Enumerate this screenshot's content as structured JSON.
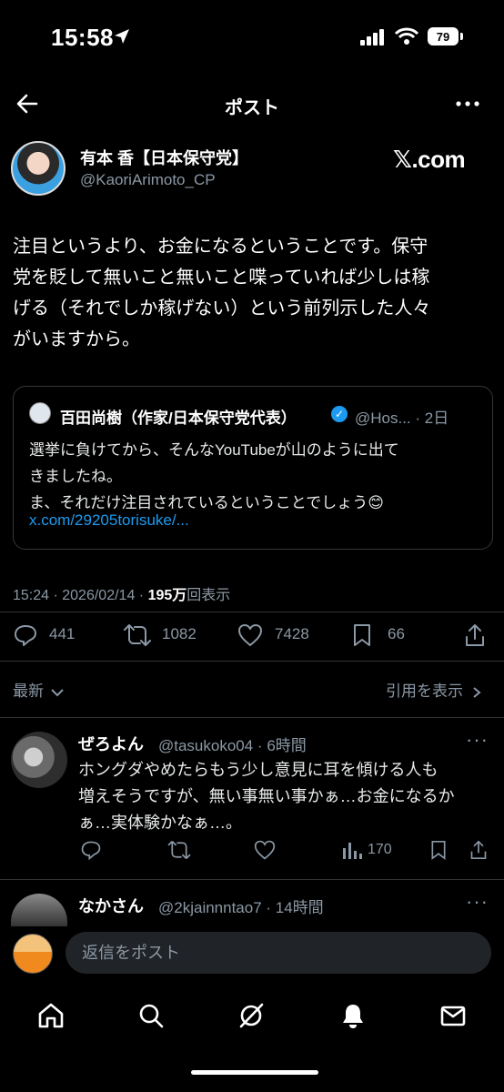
{
  "status": {
    "time": "15:58",
    "battery": "79"
  },
  "nav": {
    "title": "ポスト"
  },
  "post": {
    "author_name": "有本 香【日本保守党】",
    "author_handle": "@KaoriArimoto_CP",
    "source_badge": "𝕏.com",
    "text": "注目というより、お金になるということです。保守\n党を貶して無いこと無いこと喋っていれば少しは稼\nげる（それでしか稼げない）という前列示した人々\nがいますから。",
    "quote": {
      "author_name": "百田尚樹（作家/日本保守党代表）",
      "author_handle_time": "@Hos... · 2日",
      "text": "選挙に負けてから、そんなYouTubeが山のように出て\nきましたね。\nま、それだけ注目されているということでしょう😊",
      "link": "x.com/29205torisuke/..."
    },
    "meta": {
      "time_date": "15:24 · 2026/02/14 · ",
      "views": "195万",
      "views_suffix": "回表示"
    },
    "stats": {
      "replies": "441",
      "reposts": "1082",
      "likes": "7428",
      "bookmarks": "66"
    }
  },
  "sort": {
    "label": "最新",
    "quotes_link": "引用を表示"
  },
  "replies": [
    {
      "name": "ぜろよん",
      "handle_time": "@tasukoko04 · 6時間",
      "text": "ホングダやめたらもう少し意見に耳を傾ける人も\n増えそうですが、無い事無い事かぁ…お金になるか\nぁ…実体験かなぁ…。",
      "views": "170"
    },
    {
      "name": "なかさん",
      "handle_time": "@2kjainnntao7 · 14時間"
    }
  ],
  "reply_bar": {
    "placeholder": "返信をポスト"
  },
  "colors": {
    "background": "#000000",
    "accent": "#1d9bf0",
    "muted": "#8b98a5"
  }
}
